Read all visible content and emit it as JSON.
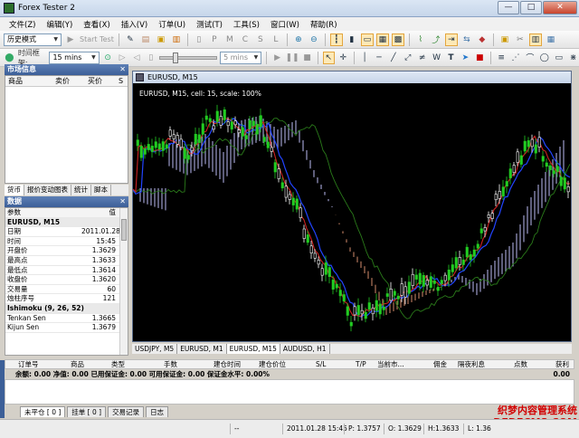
{
  "window": {
    "title": "Forex Tester 2"
  },
  "menu": [
    "文件(Z)",
    "编辑(Y)",
    "查看(X)",
    "插入(V)",
    "订单(U)",
    "测试(T)",
    "工具(S)",
    "窗口(W)",
    "帮助(R)"
  ],
  "toolbar1": {
    "mode": "历史模式",
    "start_label": "Start Test"
  },
  "toolbar2": {
    "timeframe_label": "时间框架:",
    "timeframe_value": "15 mins",
    "speed_value": "5 mins"
  },
  "market": {
    "title": "市场信息",
    "columns": [
      "商品",
      "卖价",
      "买价",
      "S"
    ]
  },
  "left_tabs": [
    "货币",
    "报价变动图表",
    "统计",
    "脚本"
  ],
  "data": {
    "title": "数据",
    "columns": [
      "参数",
      "值"
    ],
    "section": "EURUSD, M15",
    "rows": [
      {
        "k": "日期",
        "v": "2011.01.28"
      },
      {
        "k": "时间",
        "v": "15:45"
      },
      {
        "k": "开盘价",
        "v": "1.3629"
      },
      {
        "k": "最高点",
        "v": "1.3633"
      },
      {
        "k": "最低点",
        "v": "1.3614"
      },
      {
        "k": "收盘价",
        "v": "1.3620"
      },
      {
        "k": "交易量",
        "v": "60"
      },
      {
        "k": "烛柱序号",
        "v": "121"
      }
    ],
    "indicator": "Ishimoku (9, 26, 52)",
    "ind_rows": [
      {
        "k": "Tenkan Sen",
        "v": "1.3665"
      },
      {
        "k": "Kijun Sen",
        "v": "1.3679"
      }
    ]
  },
  "chart": {
    "window_title": "EURUSD, M15",
    "info": "EURUSD, M15, cell: 15, scale: 100%",
    "colors": {
      "bg": "#000000",
      "bull": "#22cc22",
      "bear": "#ffffff",
      "tenkan": "#cc2222",
      "kijun": "#2244ff",
      "chikou": "#2a7a1a",
      "cloud_up": "#d08a6a",
      "cloud_dn": "#b8b8f0"
    }
  },
  "chart_tabs": [
    "USDJPY, M5",
    "EURUSD, M1",
    "EURUSD, M15",
    "AUDUSD, H1"
  ],
  "orders": {
    "columns": [
      "订单号",
      "商品",
      "类型",
      "手数",
      "建仓时间",
      "建仓价位",
      "S/L",
      "T/P",
      "当前市...",
      "佣金",
      "隔夜利息",
      "点数",
      "获利"
    ],
    "summary": "余额: 0.00 净值: 0.00 已用保证金: 0.00 可用保证金: 0.00 保证金水平: 0.00%",
    "summary_right": "0.00"
  },
  "bottom_tabs": [
    "未平仓 [ 0 ]",
    "挂单 [ 0 ]",
    "交易记录",
    "日志"
  ],
  "status": {
    "dash": "--",
    "time": "2011.01.28 15:45",
    "p": "P: 1.3757",
    "o": "O: 1.3629",
    "h": "H:1.3633",
    "l": "L: 1.36"
  },
  "watermark": {
    "line1": "织梦内容管理系统",
    "line2": "DEDECMS.COM"
  }
}
